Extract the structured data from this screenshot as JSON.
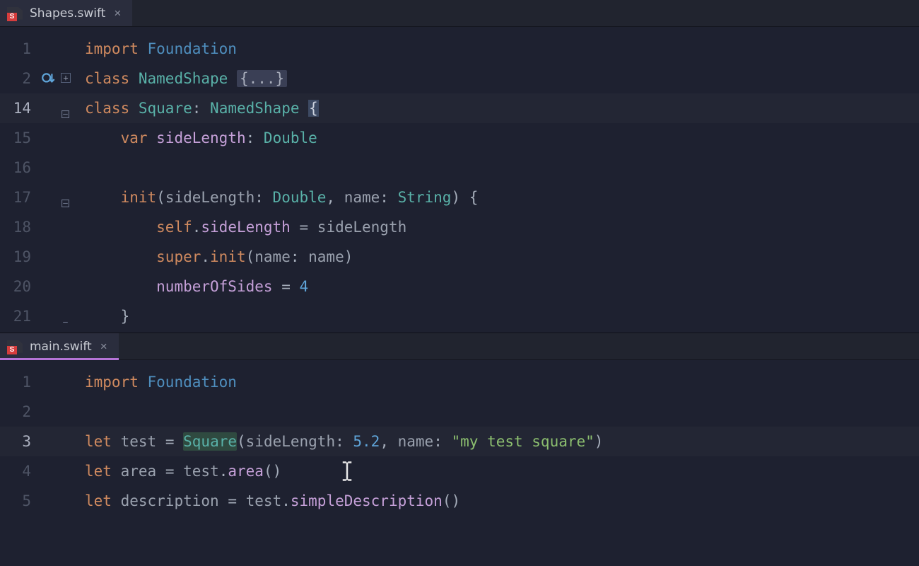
{
  "panes": {
    "top": {
      "tab": {
        "filename": "Shapes.swift"
      },
      "line_numbers": [
        "1",
        "2",
        "14",
        "15",
        "16",
        "17",
        "18",
        "19",
        "20",
        "21"
      ],
      "code": {
        "l1": {
          "kw": "import",
          "mod": "Foundation"
        },
        "l2": {
          "kw": "class",
          "name": "NamedShape",
          "folded": "{...}"
        },
        "l14": {
          "kw": "class",
          "name": "Square",
          "colon": ":",
          "base": "NamedShape",
          "brace": "{"
        },
        "l15": {
          "kw": "var",
          "prop": "sideLength",
          "colon": ":",
          "type": "Double"
        },
        "l17": {
          "kw": "init",
          "p1": "sideLength",
          "t1": "Double",
          "p2": "name",
          "t2": "String",
          "brace": "{"
        },
        "l18": {
          "self": "self",
          "prop": "sideLength",
          "eq": "=",
          "rhs": "sideLength"
        },
        "l19": {
          "super": "super",
          "fn": "init",
          "p": "name",
          "arg": "name"
        },
        "l20": {
          "prop": "numberOfSides",
          "eq": "=",
          "num": "4"
        },
        "l21": {
          "brace": "}"
        }
      }
    },
    "bottom": {
      "tab": {
        "filename": "main.swift"
      },
      "line_numbers": [
        "1",
        "2",
        "3",
        "4",
        "5"
      ],
      "code": {
        "l1": {
          "kw": "import",
          "mod": "Foundation"
        },
        "l3": {
          "kw": "let",
          "name": "test",
          "eq": "=",
          "ctor": "Square",
          "p1": "sideLength",
          "v1": "5.2",
          "p2": "name",
          "v2": "\"my test square\""
        },
        "l4": {
          "kw": "let",
          "name": "area",
          "eq": "=",
          "obj": "test",
          "call": "area"
        },
        "l5": {
          "kw": "let",
          "name": "description",
          "eq": "=",
          "obj": "test",
          "call": "simpleDescription"
        }
      }
    }
  }
}
